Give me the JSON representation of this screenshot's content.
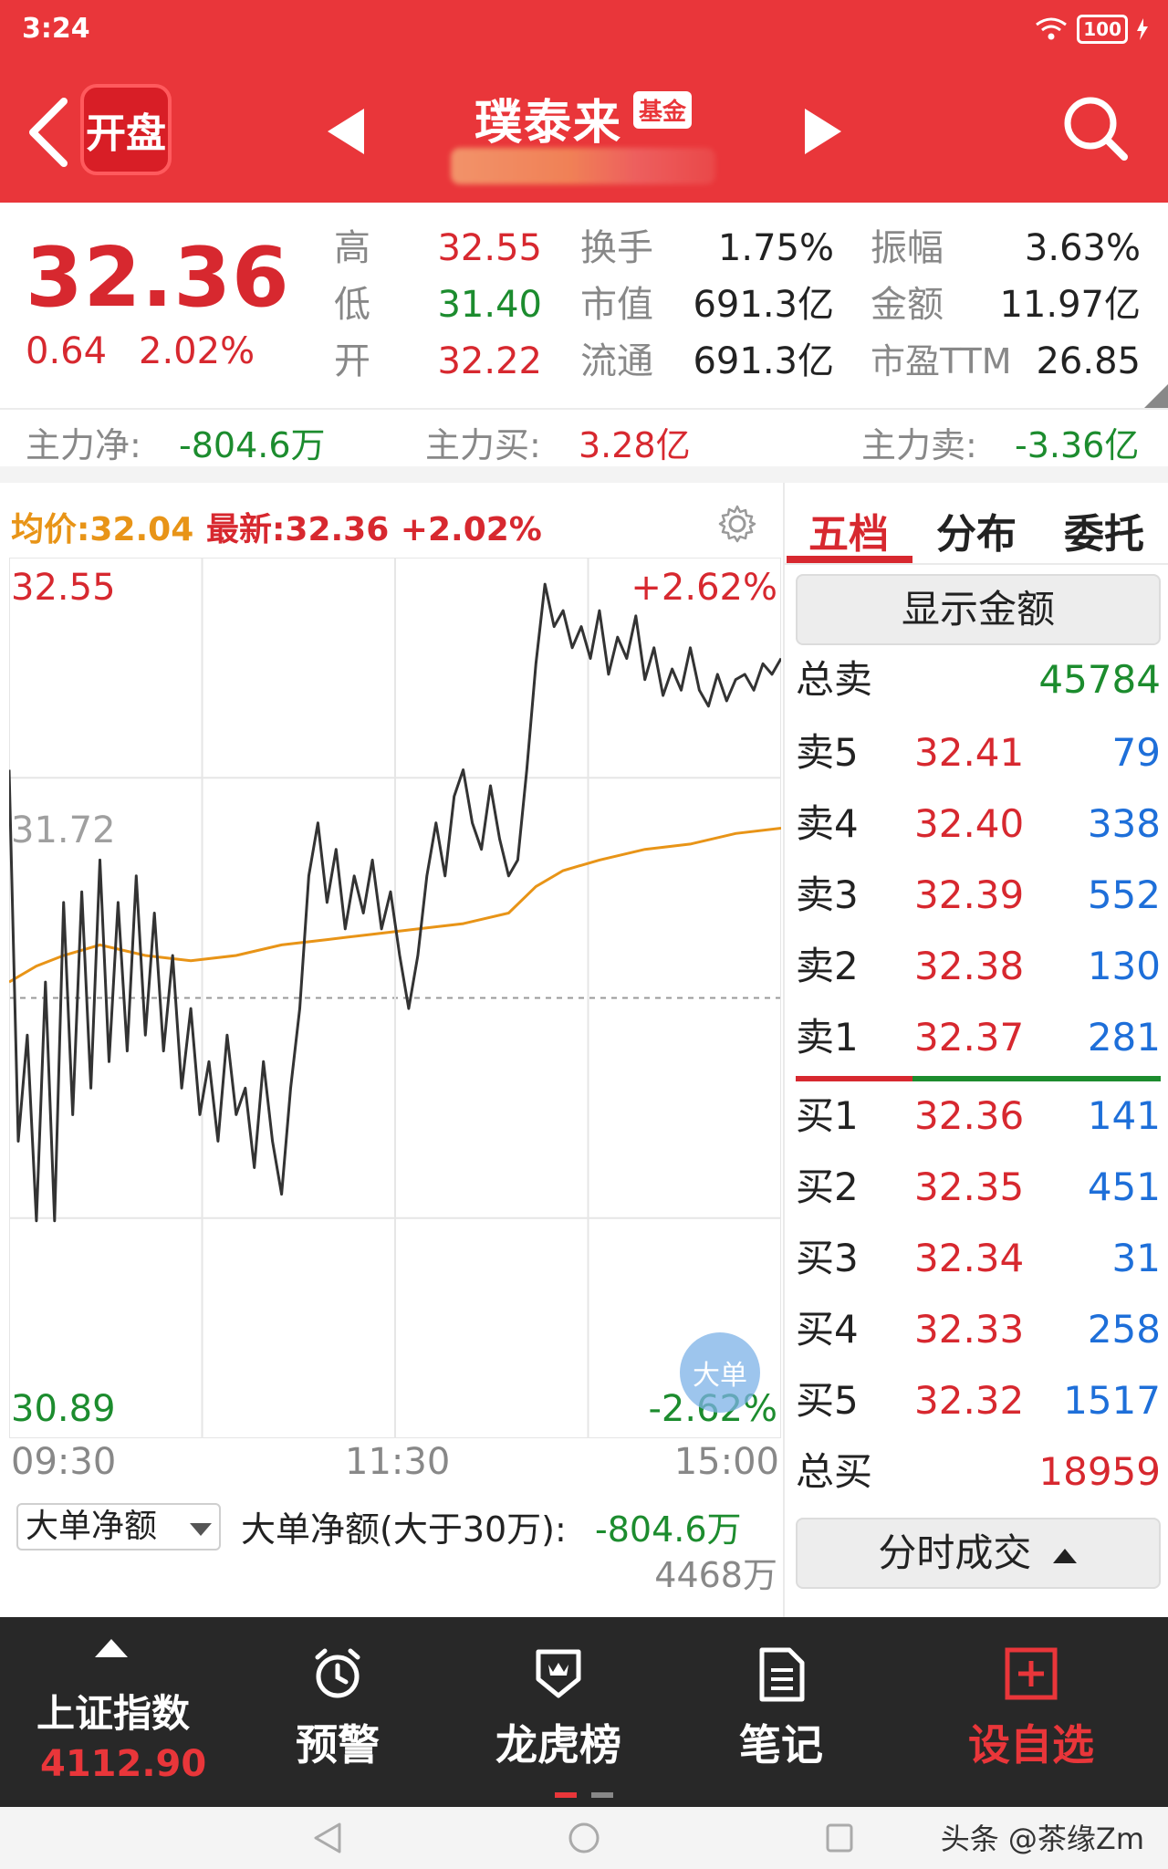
{
  "status_bar": {
    "time": "3:24",
    "battery": "100"
  },
  "header": {
    "logo_text": "开盘",
    "title": "璞泰来",
    "badge": "基金"
  },
  "quote": {
    "price": "32.36",
    "change": "0.64",
    "change_pct": "2.02%",
    "high_label": "高",
    "high": "32.55",
    "low_label": "低",
    "low": "31.40",
    "open_label": "开",
    "open": "32.22",
    "turnover_label": "换手",
    "turnover": "1.75%",
    "mktcap_label": "市值",
    "mktcap": "691.3亿",
    "float_label": "流通",
    "float_cap": "691.3亿",
    "amplitude_label": "振幅",
    "amplitude": "3.63%",
    "amount_label": "金额",
    "amount": "11.97亿",
    "pe_label": "市盈TTM",
    "pe": "26.85"
  },
  "main_force": {
    "net_label": "主力净:",
    "net": "-804.6万",
    "buy_label": "主力买:",
    "buy": "3.28亿",
    "sell_label": "主力卖:",
    "sell": "-3.36亿"
  },
  "chart_header": {
    "avg": "均价:32.04",
    "latest": "最新:32.36 +2.02%"
  },
  "chart_data": {
    "type": "line",
    "y_top": "32.55",
    "y_mid": "31.72",
    "y_bottom": "30.89",
    "pct_top": "+2.62%",
    "pct_bottom": "-2.62%",
    "ylim": [
      30.89,
      32.55
    ],
    "x_ticks": [
      "09:30",
      "11:30",
      "15:00"
    ],
    "series": [
      {
        "name": "最新",
        "color": "#333333",
        "points": [
          [
            0,
            32.15
          ],
          [
            2,
            31.45
          ],
          [
            4,
            31.65
          ],
          [
            6,
            31.3
          ],
          [
            8,
            31.75
          ],
          [
            10,
            31.3
          ],
          [
            12,
            31.9
          ],
          [
            14,
            31.5
          ],
          [
            16,
            31.92
          ],
          [
            18,
            31.55
          ],
          [
            20,
            31.98
          ],
          [
            22,
            31.6
          ],
          [
            24,
            31.9
          ],
          [
            26,
            31.62
          ],
          [
            28,
            31.95
          ],
          [
            30,
            31.65
          ],
          [
            32,
            31.88
          ],
          [
            34,
            31.62
          ],
          [
            36,
            31.8
          ],
          [
            38,
            31.55
          ],
          [
            40,
            31.7
          ],
          [
            42,
            31.5
          ],
          [
            44,
            31.6
          ],
          [
            46,
            31.45
          ],
          [
            48,
            31.65
          ],
          [
            50,
            31.5
          ],
          [
            52,
            31.55
          ],
          [
            54,
            31.4
          ],
          [
            56,
            31.6
          ],
          [
            58,
            31.45
          ],
          [
            60,
            31.35
          ],
          [
            62,
            31.55
          ],
          [
            64,
            31.7
          ],
          [
            66,
            31.95
          ],
          [
            68,
            32.05
          ],
          [
            70,
            31.9
          ],
          [
            72,
            32.0
          ],
          [
            74,
            31.85
          ],
          [
            76,
            31.95
          ],
          [
            78,
            31.88
          ],
          [
            80,
            31.98
          ],
          [
            82,
            31.85
          ],
          [
            84,
            31.92
          ],
          [
            86,
            31.8
          ],
          [
            88,
            31.7
          ],
          [
            90,
            31.8
          ],
          [
            92,
            31.95
          ],
          [
            94,
            32.05
          ],
          [
            96,
            31.95
          ],
          [
            98,
            32.1
          ],
          [
            100,
            32.15
          ],
          [
            102,
            32.05
          ],
          [
            104,
            32.0
          ],
          [
            106,
            32.12
          ],
          [
            108,
            32.02
          ],
          [
            110,
            31.95
          ],
          [
            112,
            31.98
          ],
          [
            114,
            32.15
          ],
          [
            116,
            32.35
          ],
          [
            118,
            32.5
          ],
          [
            120,
            32.42
          ],
          [
            122,
            32.45
          ],
          [
            124,
            32.38
          ],
          [
            126,
            32.42
          ],
          [
            128,
            32.36
          ],
          [
            130,
            32.45
          ],
          [
            132,
            32.33
          ],
          [
            134,
            32.4
          ],
          [
            136,
            32.36
          ],
          [
            138,
            32.44
          ],
          [
            140,
            32.32
          ],
          [
            142,
            32.38
          ],
          [
            144,
            32.29
          ],
          [
            146,
            32.34
          ],
          [
            148,
            32.3
          ],
          [
            150,
            32.38
          ],
          [
            152,
            32.3
          ],
          [
            154,
            32.27
          ],
          [
            156,
            32.33
          ],
          [
            158,
            32.28
          ],
          [
            160,
            32.32
          ],
          [
            162,
            32.33
          ],
          [
            164,
            32.3
          ],
          [
            166,
            32.35
          ],
          [
            168,
            32.33
          ],
          [
            170,
            32.36
          ]
        ]
      },
      {
        "name": "均价",
        "color": "#e89417",
        "points": [
          [
            0,
            31.75
          ],
          [
            6,
            31.78
          ],
          [
            12,
            31.8
          ],
          [
            20,
            31.82
          ],
          [
            30,
            31.8
          ],
          [
            40,
            31.79
          ],
          [
            50,
            31.8
          ],
          [
            60,
            31.82
          ],
          [
            70,
            31.83
          ],
          [
            80,
            31.84
          ],
          [
            90,
            31.85
          ],
          [
            100,
            31.86
          ],
          [
            110,
            31.88
          ],
          [
            116,
            31.93
          ],
          [
            122,
            31.96
          ],
          [
            130,
            31.98
          ],
          [
            140,
            32.0
          ],
          [
            150,
            32.01
          ],
          [
            160,
            32.03
          ],
          [
            170,
            32.04
          ]
        ]
      }
    ]
  },
  "volume": {
    "selector": "大单净额",
    "net_label": "大单净额(大于30万):",
    "net_value": "-804.6万",
    "amount": "4468万",
    "bubble": "大单"
  },
  "order_book": {
    "tabs": [
      "五档",
      "分布",
      "委托"
    ],
    "show_amount": "显示金额",
    "total_sell_label": "总卖",
    "total_sell": "45784",
    "sells": [
      {
        "label": "卖5",
        "price": "32.41",
        "vol": "79"
      },
      {
        "label": "卖4",
        "price": "32.40",
        "vol": "338"
      },
      {
        "label": "卖3",
        "price": "32.39",
        "vol": "552"
      },
      {
        "label": "卖2",
        "price": "32.38",
        "vol": "130"
      },
      {
        "label": "卖1",
        "price": "32.37",
        "vol": "281"
      }
    ],
    "buys": [
      {
        "label": "买1",
        "price": "32.36",
        "vol": "141"
      },
      {
        "label": "买2",
        "price": "32.35",
        "vol": "451"
      },
      {
        "label": "买3",
        "price": "32.34",
        "vol": "31"
      },
      {
        "label": "买4",
        "price": "32.33",
        "vol": "258"
      },
      {
        "label": "买5",
        "price": "32.32",
        "vol": "1517"
      }
    ],
    "total_buy_label": "总买",
    "total_buy": "18959",
    "ticks_btn": "分时成交"
  },
  "bottom_nav": {
    "index_name": "上证指数",
    "index_value": "4112.90",
    "alert": "预警",
    "dragon": "龙虎榜",
    "notes": "笔记",
    "add_watch": "设自选"
  },
  "watermark": "头条 @茶缘Zm"
}
